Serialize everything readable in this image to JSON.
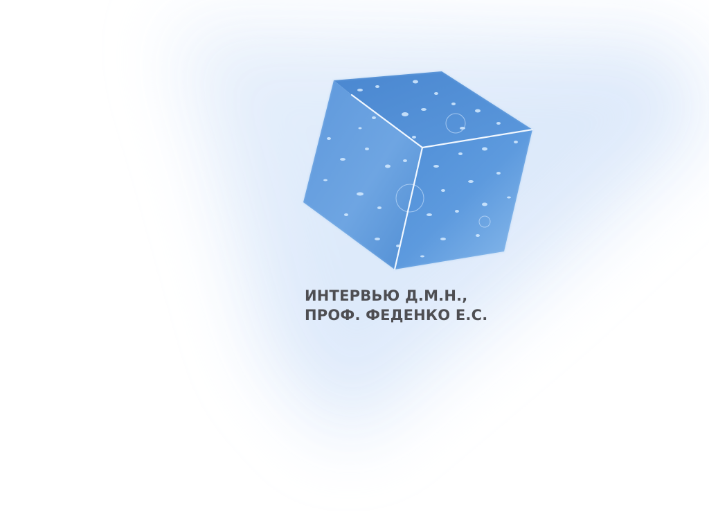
{
  "title": {
    "line1": "ИНТЕРВЬЮ Д.М.Н.,",
    "line2": "ПРОФ. ФЕДЕНКО Е.С."
  },
  "colors": {
    "background": "#ffffff",
    "glow": "#dce9fb",
    "cube_light": "#7fb2e8",
    "cube_dark": "#3f7cc9",
    "text": "#4e4e52"
  },
  "icons": {
    "illustration": "ice-cube-illustration"
  }
}
